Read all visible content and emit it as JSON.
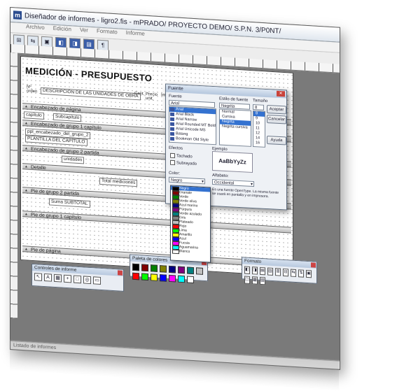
{
  "window": {
    "app_icon": "m",
    "title": "Diseñador de informes - ligro2.fis - mPRADO/ PROYECTO DEMO/ S.P.N. 3/P0NT/",
    "menu": [
      "Archivo",
      "Edición",
      "Ver",
      "Formato",
      "Informe"
    ],
    "toolbar": [
      "⊞",
      "⇆",
      "▣",
      "◧",
      "◨",
      "▤",
      "¶"
    ],
    "status_text": "Listado de informes"
  },
  "report": {
    "heading": "MEDICIÓN - PRESUPUESTO",
    "columns": [
      "Nº orden",
      "DESCRIPCIÓN DE LAS UNIDADES DE OBRA",
      "Cant.",
      "Precio unit.",
      "Importe"
    ],
    "bands": [
      "Encabezado de página",
      "Encabezado de grupo 1 capítulo",
      "Encabezado de grupo 2 partida",
      "Detalle",
      "Pie de grupo 2 partida",
      "Pie de grupo 1 capítulo",
      "Pie de página"
    ],
    "fields": [
      "capítulo",
      "Subcapítulo",
      "ppl_encabezado_del_grupo_2",
      "PLANTILLA DEL CAPÍTULO",
      "unidades",
      "Total mediciones",
      "Suma SUBTOTAL"
    ]
  },
  "font_dialog": {
    "title": "Fuente",
    "font_label": "Fuente",
    "style_label": "Estilo de fuente",
    "size_label": "Tamaño",
    "font_value": "Arial",
    "style_value": "Negrita",
    "size_value": "8",
    "fonts": [
      "Arial",
      "Arial Black",
      "Arial Narrow",
      "Arial Rounded MT Bold",
      "Arial Unicode MS",
      "Batang",
      "Bookman Old Style"
    ],
    "styles": [
      "Normal",
      "Cursiva",
      "Negrita",
      "Negrita cursiva"
    ],
    "sizes": [
      "8",
      "9",
      "10",
      "11",
      "12",
      "14",
      "16"
    ],
    "accept": "Aceptar",
    "cancel": "Cancelar",
    "help": "Ayuda",
    "effects_label": "Efectos",
    "strikeout": "Tachado",
    "underline": "Subrayado",
    "color_label": "Color:",
    "color_value": "Negro",
    "sample_label": "Ejemplo",
    "sample_text": "AaBbYyZz",
    "script_label": "Alfabeto:",
    "script_value": "Occidental",
    "note": "Es una fuente OpenType. La misma fuente se usará en pantalla y en impresora."
  },
  "color_list": [
    {
      "name": "Negro",
      "color": "#000000"
    },
    {
      "name": "Granate",
      "color": "#800000"
    },
    {
      "name": "Verde",
      "color": "#008000"
    },
    {
      "name": "Verde oliva",
      "color": "#808000"
    },
    {
      "name": "Azul marino",
      "color": "#000080"
    },
    {
      "name": "Púrpura",
      "color": "#800080"
    },
    {
      "name": "Verde azulado",
      "color": "#008080"
    },
    {
      "name": "Gris",
      "color": "#808080"
    },
    {
      "name": "Plateado",
      "color": "#c0c0c0"
    },
    {
      "name": "Rojo",
      "color": "#ff0000"
    },
    {
      "name": "Lima",
      "color": "#00ff00"
    },
    {
      "name": "Amarillo",
      "color": "#ffff00"
    },
    {
      "name": "Azul",
      "color": "#0000ff"
    },
    {
      "name": "Fucsia",
      "color": "#ff00ff"
    },
    {
      "name": "Aguamarina",
      "color": "#00ffff"
    },
    {
      "name": "Blanco",
      "color": "#ffffff"
    }
  ],
  "palettes": {
    "controls_title": "Controles de informe",
    "colors_title": "Paleta de colores",
    "format_title": "Formato",
    "control_icons": [
      "↖",
      "A",
      "▦",
      "+",
      "□",
      "◎",
      "▭"
    ],
    "swatches": [
      "#000000",
      "#800000",
      "#008000",
      "#808000",
      "#000080",
      "#800080",
      "#008080",
      "#c0c0c0",
      "#ff0000",
      "#00ff00",
      "#ffff00",
      "#0000ff",
      "#ff00ff",
      "#00ffff",
      "#ffffff"
    ],
    "format_icons": [
      "◧",
      "◨",
      "▤",
      "▥",
      "⊞",
      "⊟",
      "⇆",
      "⇅",
      "▣",
      "◫",
      "▦",
      "▧"
    ]
  }
}
